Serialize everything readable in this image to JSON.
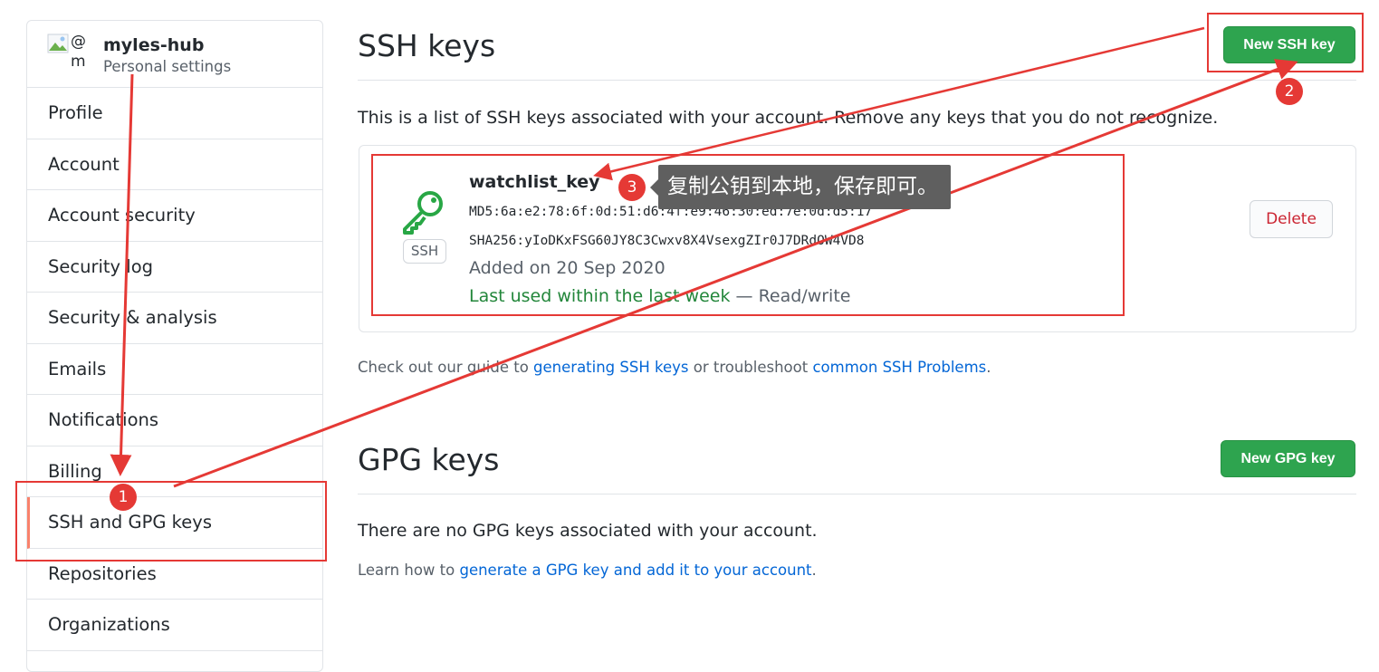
{
  "sidebar": {
    "username": "myles-hub",
    "subtitle": "Personal settings",
    "avatar_at": "@",
    "avatar_m": "m",
    "items": [
      {
        "label": "Profile"
      },
      {
        "label": "Account"
      },
      {
        "label": "Account security"
      },
      {
        "label": "Security log"
      },
      {
        "label": "Security & analysis"
      },
      {
        "label": "Emails"
      },
      {
        "label": "Notifications"
      },
      {
        "label": "Billing"
      },
      {
        "label": "SSH and GPG keys"
      },
      {
        "label": "Repositories"
      },
      {
        "label": "Organizations"
      }
    ],
    "active_item": "SSH and GPG keys"
  },
  "ssh": {
    "title": "SSH keys",
    "new_button": "New SSH key",
    "description": "This is a list of SSH keys associated with your account. Remove any keys that you do not recognize.",
    "key": {
      "name": "watchlist_key",
      "md5": "MD5:6a:e2:78:6f:0d:51:d6:4f:e9:46:30:ed:7e:0d:d5:17",
      "sha256": "SHA256:yIoDKxFSG60JY8C3Cwxv8X4VsexgZIr0J7DRdOW4VD8",
      "badge": "SSH",
      "added": "Added on 20 Sep 2020",
      "last_used": "Last used within the last week",
      "access": " — Read/write",
      "delete_button": "Delete"
    },
    "guide_prefix": "Check out our guide to ",
    "guide_link1": "generating SSH keys",
    "guide_mid": " or troubleshoot ",
    "guide_link2": "common SSH Problems",
    "guide_suffix": "."
  },
  "gpg": {
    "title": "GPG keys",
    "new_button": "New GPG key",
    "empty": "There are no GPG keys associated with your account.",
    "learn_prefix": "Learn how to ",
    "learn_link": "generate a GPG key and add it to your account",
    "learn_suffix": "."
  },
  "annotations": {
    "badge1": "1",
    "badge2": "2",
    "badge3": "3",
    "tooltip": "复制公钥到本地，保存即可。",
    "color": "#e53935"
  },
  "colors": {
    "green_button": "#2ea44f",
    "link": "#0366d6",
    "danger": "#cb2431",
    "key_icon": "#28a745",
    "active_indicator": "#f9826c"
  }
}
